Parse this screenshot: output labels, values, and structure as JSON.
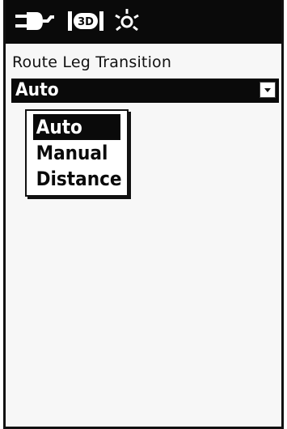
{
  "status_bar": {
    "icons": [
      "power-plug-icon",
      "satellite-signal-icon",
      "backlight-icon"
    ]
  },
  "route_leg": {
    "label": "Route Leg Transition",
    "selected_value": "Auto",
    "options": [
      {
        "label": "Auto",
        "selected": true
      },
      {
        "label": "Manual",
        "selected": false
      },
      {
        "label": "Distance",
        "selected": false
      }
    ]
  },
  "colors": {
    "foreground": "#0a0a0a",
    "background": "#f7f7f7"
  }
}
